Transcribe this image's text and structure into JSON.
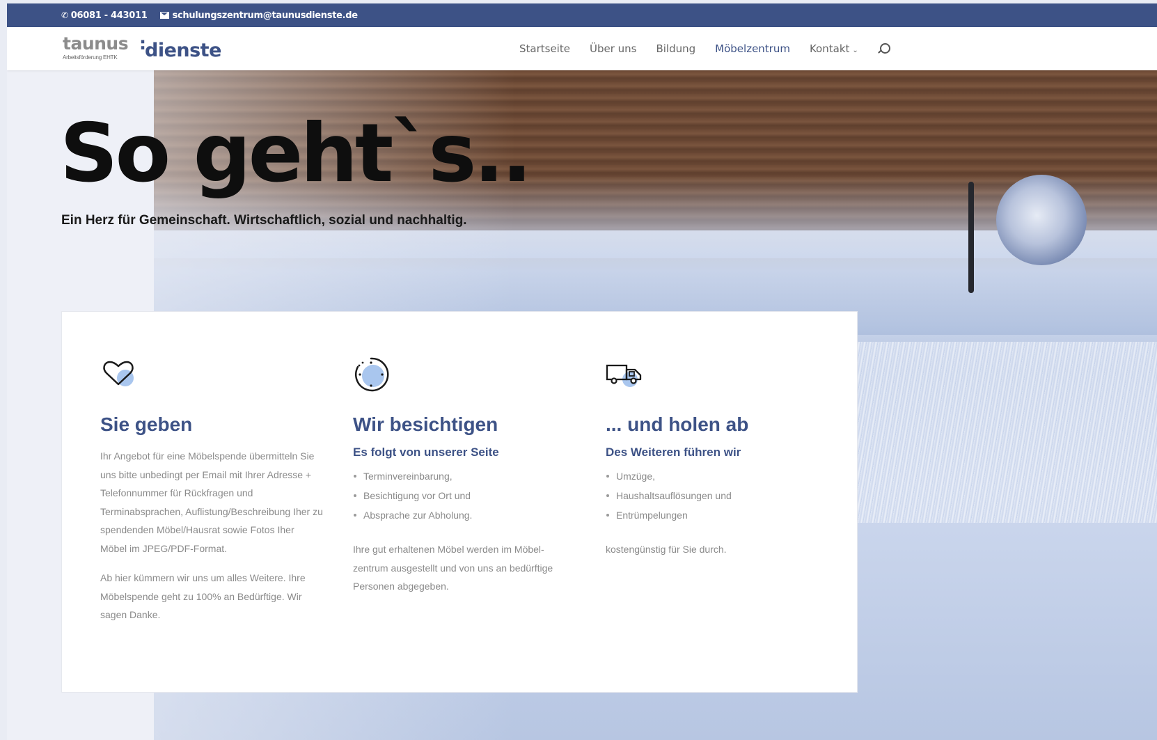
{
  "topbar": {
    "phone": "06081 - 443011",
    "email": "schulungszentrum@taunusdienste.de"
  },
  "logo": {
    "taunus": "taunus",
    "dienste": "dienste",
    "subtitle": "Arbeitsförderung EHTK"
  },
  "nav": {
    "items": [
      {
        "label": "Startseite",
        "active": false
      },
      {
        "label": "Über uns",
        "active": false
      },
      {
        "label": "Bildung",
        "active": false
      },
      {
        "label": "Möbelzentrum",
        "active": true
      },
      {
        "label": "Kontakt",
        "active": false
      }
    ]
  },
  "hero": {
    "title": "So geht`s..",
    "subtitle": "Ein Herz für Gemeinschaft. Wirtschaftlich, sozial und nachhaltig."
  },
  "columns": [
    {
      "icon": "heart-icon",
      "heading": "Sie geben",
      "paragraph1": "Ihr Angebot für eine Möbelspende übermitteln Sie uns bitte unbedingt per Email mit Ihrer Adresse + Telefonnummer für Rückfragen und Terminabsprachen, Auflistung/Beschreibung Iher zu spendenden Möbel/Hausrat sowie Fotos Iher Möbel im JPEG/PDF-Format.",
      "paragraph2": "Ab hier kümmern wir uns um alles Weitere. Ihre Möbelspende geht zu 100% an Bedürftige. Wir sagen Danke."
    },
    {
      "icon": "clock-icon",
      "heading": "Wir besichtigen",
      "subheading": "Es folgt von unserer Seite",
      "list": [
        "Terminvereinbarung,",
        "Besichtigung vor Ort und",
        "Absprache zur Abholung."
      ],
      "text": "Ihre gut erhaltenen Möbel werden im Möbel-zentrum ausgestellt und von uns an bedürftige Personen abgegeben."
    },
    {
      "icon": "truck-icon",
      "heading": "... und holen ab",
      "subheading": "Des Weiteren führen wir",
      "list": [
        "Umzüge,",
        "Haushaltsauflösungen und",
        "Entrümpelungen"
      ],
      "text": "kostengünstig für Sie durch."
    }
  ],
  "colors": {
    "brand": "#3d5286",
    "accent_light": "#a9c6ee",
    "text_muted": "#8a8a8a"
  }
}
